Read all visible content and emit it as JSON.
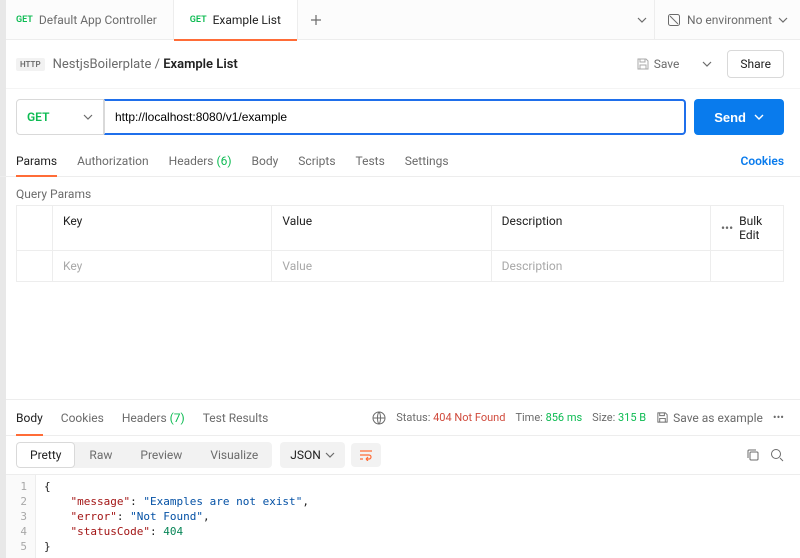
{
  "tabs": [
    {
      "method": "GET",
      "title": "Default App Controller"
    },
    {
      "method": "GET",
      "title": "Example List"
    }
  ],
  "env": {
    "label": "No environment"
  },
  "breadcrumb": {
    "workspace": "NestjsBoilerplate",
    "current": "Example List"
  },
  "actions": {
    "save": "Save",
    "share": "Share"
  },
  "request": {
    "method": "GET",
    "url": "http://localhost:8080/v1/example",
    "send": "Send"
  },
  "reqTabs": {
    "params": "Params",
    "auth": "Authorization",
    "headersLabel": "Headers",
    "headersCount": "(6)",
    "body": "Body",
    "scripts": "Scripts",
    "tests": "Tests",
    "settings": "Settings",
    "cookies": "Cookies"
  },
  "queryParams": {
    "title": "Query Params",
    "cols": {
      "key": "Key",
      "value": "Value",
      "desc": "Description",
      "bulk": "Bulk Edit"
    },
    "placeholders": {
      "key": "Key",
      "value": "Value",
      "desc": "Description"
    }
  },
  "response": {
    "tabs": {
      "body": "Body",
      "cookies": "Cookies",
      "headersLabel": "Headers",
      "headersCount": "(7)",
      "tests": "Test Results"
    },
    "statusLabel": "Status:",
    "statusValue": "404 Not Found",
    "timeLabel": "Time:",
    "timeValue": "856 ms",
    "sizeLabel": "Size:",
    "sizeValue": "315 B",
    "saveExample": "Save as example"
  },
  "view": {
    "pretty": "Pretty",
    "raw": "Raw",
    "preview": "Preview",
    "visualize": "Visualize",
    "format": "JSON"
  },
  "json": {
    "lines": [
      "1",
      "2",
      "3",
      "4",
      "5"
    ],
    "body": {
      "message": "Examples are not exist",
      "error": "Not Found",
      "statusCode": 404
    }
  }
}
